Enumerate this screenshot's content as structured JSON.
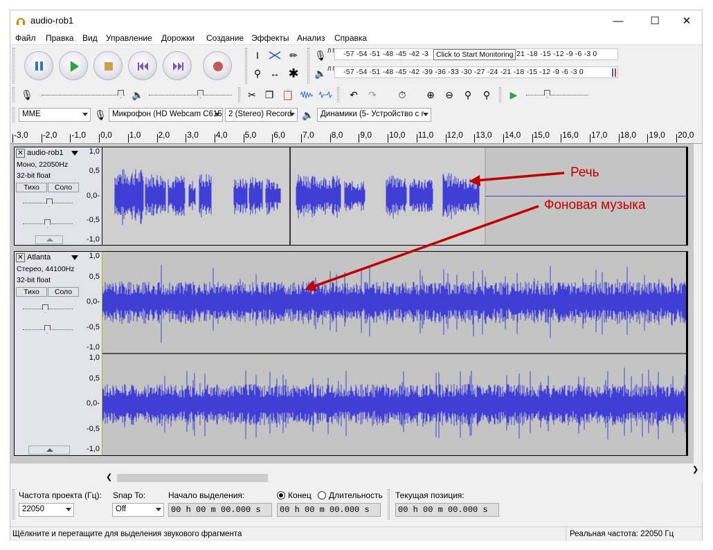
{
  "window": {
    "title": "audio-rob1"
  },
  "menu": [
    "Файл",
    "Правка",
    "Вид",
    "Управление",
    "Дорожки",
    "Создание",
    "Эффекты",
    "Анализ",
    "Справка"
  ],
  "meters": {
    "rec_scale": "-57 -54 -51 -48 -45 -42 -3",
    "rec_scale_tail": "21 -18 -15 -12  -9  -6  -3  0",
    "play_scale": "-57 -54 -51 -48 -45 -42 -39 -36 -33 -30 -27 -24 -21 -18 -15 -12  -9  -6  -3  0",
    "monitor_tip": "Click to Start Monitoring",
    "lr_label": "Л П"
  },
  "device": {
    "host": "MME",
    "mic": "Микрофон (HD Webcam C615",
    "channels": "2 (Stereo) Record",
    "output": "Динамики (5- Устройство с г"
  },
  "ruler": [
    "-3,0",
    "-2,0",
    "-1,0",
    "0,0",
    "1,0",
    "2,0",
    "3,0",
    "4,0",
    "5,0",
    "6,0",
    "7,0",
    "8,0",
    "9,0",
    "10,0",
    "11,0",
    "12,0",
    "13,0",
    "14,0",
    "15,0",
    "16,0",
    "17,0",
    "18,0",
    "19,0",
    "20,0"
  ],
  "tracks": [
    {
      "name": "audio-rob1",
      "info1": "Моно, 22050Hz",
      "info2": "32-bit float",
      "mute": "Тихо",
      "solo": "Соло"
    },
    {
      "name": "Atlanta",
      "info1": "Стерео, 44100Hz",
      "info2": "32-bit float",
      "mute": "Тихо",
      "solo": "Соло"
    }
  ],
  "vscale": [
    "1,0",
    "0,5",
    "0,0-",
    "-0,5",
    "-1,0"
  ],
  "annotations": {
    "speech": "Речь",
    "music": "Фоновая музыка"
  },
  "selection": {
    "rate_label": "Частота проекта (Гц):",
    "rate_value": "22050",
    "snap_label": "Snap To:",
    "snap_value": "Off",
    "start_label": "Начало выделения:",
    "end_label": "Конец",
    "length_label": "Длительность",
    "position_label": "Текущая позиция:",
    "time_value": "00 h 00 m 00.000 s"
  },
  "status": {
    "hint": "Щёлкните и перетащите для выделения звукового фрагмента",
    "rate": "Реальная частота: 22050 Гц"
  },
  "colors": {
    "wave": "#3f3fd6",
    "wave_light": "#6b6be6",
    "annotation": "#c00000",
    "wave_bg": "#c4c4c4"
  }
}
